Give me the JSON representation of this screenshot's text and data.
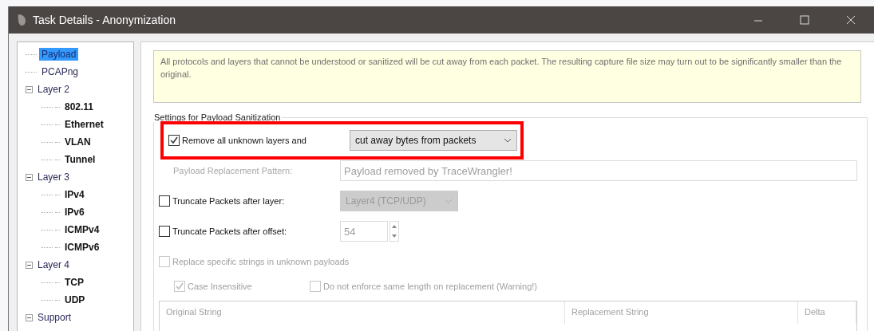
{
  "window": {
    "title": "Task Details - Anonymization"
  },
  "tree": [
    {
      "label": "Payload",
      "selected": true
    },
    {
      "label": "PCAPng",
      "selected": false
    },
    {
      "label": "Layer 2",
      "selected": false,
      "expanded": true,
      "children": [
        {
          "label": "802.11",
          "selected": false
        },
        {
          "label": "Ethernet",
          "selected": false
        },
        {
          "label": "VLAN",
          "selected": false
        },
        {
          "label": "Tunnel",
          "selected": false
        }
      ]
    },
    {
      "label": "Layer 3",
      "selected": false,
      "expanded": true,
      "children": [
        {
          "label": "IPv4",
          "selected": false
        },
        {
          "label": "IPv6",
          "selected": false
        },
        {
          "label": "ICMPv4",
          "selected": false
        },
        {
          "label": "ICMPv6",
          "selected": false
        }
      ]
    },
    {
      "label": "Layer 4",
      "selected": false,
      "expanded": true,
      "children": [
        {
          "label": "TCP",
          "selected": false
        },
        {
          "label": "UDP",
          "selected": false
        }
      ]
    },
    {
      "label": "Support",
      "selected": false,
      "expanded": true
    }
  ],
  "info": "All protocols and layers that cannot be understood or sanitized will be cut away from each packet. The resulting capture file size may turn out to be significantly smaller than the original.",
  "settings": {
    "title": "Settings for Payload Sanitization",
    "rows": [
      {
        "kind": "check-select",
        "label": "Remove all unknown layers and",
        "checked": true,
        "disabled": false,
        "value": "cut away bytes from packets",
        "value_disabled": false,
        "highlighted": true
      },
      {
        "kind": "text",
        "label": "Payload Replacement Pattern:",
        "disabled": true,
        "value": "Payload removed by TraceWrangler!"
      },
      {
        "kind": "check-select",
        "label": "Truncate Packets after layer:",
        "checked": false,
        "disabled": false,
        "value": "Layer4 (TCP/UDP)",
        "value_disabled": true,
        "highlighted": false
      },
      {
        "kind": "check-spin",
        "label": "Truncate Packets after offset:",
        "checked": false,
        "disabled": false,
        "value": "54"
      },
      {
        "kind": "check",
        "label": "Replace specific strings in unknown payloads",
        "checked": false,
        "disabled": true
      }
    ],
    "sub_options": [
      {
        "label": "Case Insensitive",
        "checked": true,
        "disabled": true
      },
      {
        "label": "Do not enforce same length on replacement (Warning!)",
        "checked": false,
        "disabled": true
      }
    ],
    "table": {
      "columns": [
        "Original String",
        "Replacement String",
        "Delta"
      ]
    }
  }
}
